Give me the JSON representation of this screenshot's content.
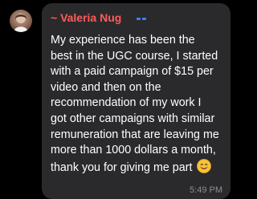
{
  "sender": {
    "name": "~ Valeria Nug"
  },
  "message": {
    "lines": [
      "My experience has been the",
      "best in the UGC course, I started",
      "with a paid campaign of $15 per",
      "video and then on the",
      "recommendation of my work I",
      "got other campaigns with similar",
      "remuneration that are leaving me",
      "more than 1000 dollars a month,",
      "thank you for giving me part"
    ],
    "emoji": "smiling-face-icon",
    "time": "5:49 PM"
  },
  "colors": {
    "background": "#000000",
    "bubble": "#2a2a2c",
    "sender_name": "#ff5c5c",
    "text": "#ffffff",
    "timestamp": "#8e8e93"
  }
}
